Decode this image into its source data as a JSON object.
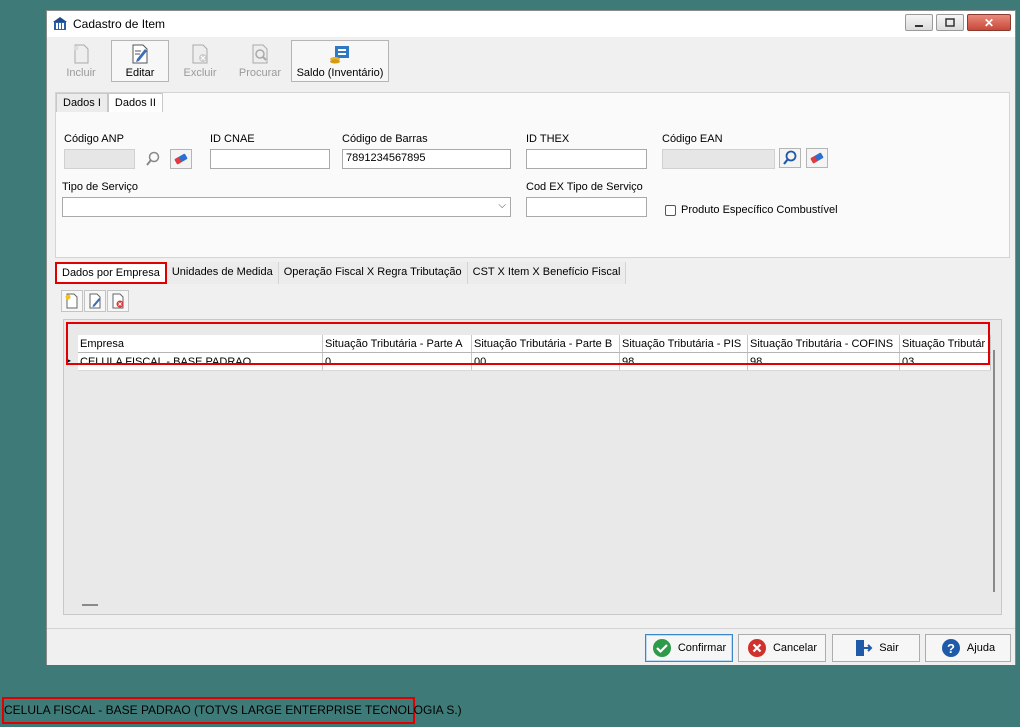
{
  "window": {
    "title": "Cadastro de Item",
    "close_glyph": "✕"
  },
  "toolbar": {
    "incluir": "Incluir",
    "editar": "Editar",
    "excluir": "Excluir",
    "procurar": "Procurar",
    "saldo": "Saldo (Inventário)"
  },
  "tabs_top": [
    "Dados I",
    "Dados II"
  ],
  "form": {
    "codigo_anp": {
      "label": "Código ANP",
      "value": ""
    },
    "id_cnae": {
      "label": "ID CNAE",
      "value": ""
    },
    "codigo_barras": {
      "label": "Código de Barras",
      "value": "7891234567895"
    },
    "id_thex": {
      "label": "ID THEX",
      "value": ""
    },
    "codigo_ean": {
      "label": "Código EAN",
      "value": ""
    },
    "tipo_servico": {
      "label": "Tipo de Serviço",
      "value": ""
    },
    "cod_ex": {
      "label": "Cod EX Tipo de Serviço",
      "value": ""
    },
    "produto_combustivel": {
      "label": "Produto Específico Combustível",
      "checked": false
    }
  },
  "tabs_bottom": [
    "Dados por Empresa",
    "Unidades de Medida",
    "Operação Fiscal X Regra Tributação",
    "CST X Item X Benefício Fiscal"
  ],
  "grid": {
    "columns": [
      "Empresa",
      "Situação Tributária - Parte A",
      "Situação Tributária - Parte B",
      "Situação Tributária - PIS",
      "Situação Tributária - COFINS",
      "Situação Tributár"
    ],
    "rows": [
      [
        "CELULA FISCAL - BASE PADRAO",
        "0",
        "00",
        "98",
        "98",
        "03"
      ]
    ]
  },
  "footer": {
    "confirmar": "Confirmar",
    "cancelar": "Cancelar",
    "sair": "Sair",
    "ajuda": "Ajuda"
  },
  "status": "CELULA FISCAL - BASE PADRAO (TOTVS LARGE ENTERPRISE TECNOLOGIA S.)",
  "colors": {
    "highlight_red": "#e00000",
    "desktop": "#3e7b78"
  }
}
